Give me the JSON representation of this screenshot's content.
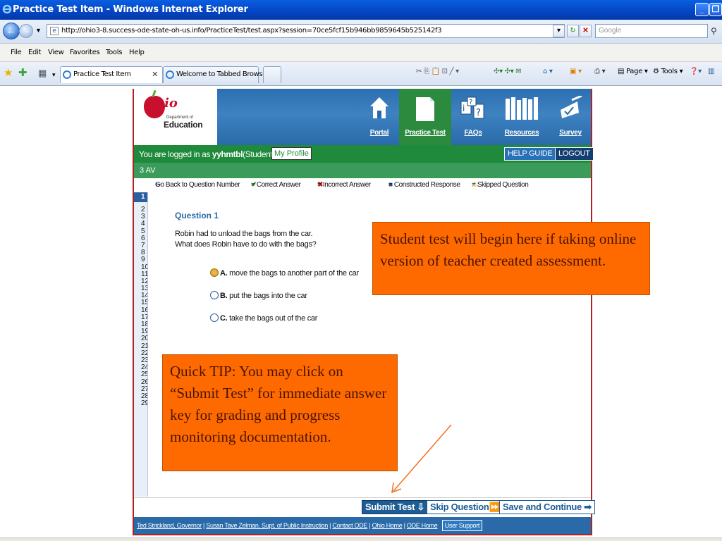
{
  "window": {
    "title": "Practice Test Item - Windows Internet Explorer",
    "url": "http://ohio3-8.success-ode-state-oh-us.info/PracticeTest/test.aspx?session=70ce5fcf15b946bb9859645b525142f3",
    "search_placeholder": "Google"
  },
  "menu": {
    "file": "File",
    "edit": "Edit",
    "view": "View",
    "favorites": "Favorites",
    "tools": "Tools",
    "help": "Help"
  },
  "tabs": [
    {
      "label": "Practice Test Item"
    },
    {
      "label": "Welcome to Tabbed Browsing"
    }
  ],
  "toolbar": {
    "page": "Page",
    "tools": "Tools"
  },
  "site": {
    "dept_line": "Department of",
    "edu_line": "Education",
    "nav": [
      {
        "label": "Portal"
      },
      {
        "label": "Practice Test"
      },
      {
        "label": "FAQs"
      },
      {
        "label": "Resources"
      },
      {
        "label": "Survey"
      }
    ]
  },
  "session": {
    "prefix": "You are logged in as ",
    "username": "yyhmtbl",
    "role": "(Student)",
    "profile": "My Profile",
    "help_guide": "HELP GUIDE",
    "logout": "LOGOUT"
  },
  "section": "3 AV",
  "legend": {
    "back": "Go Back to Question Number",
    "correct": "= Correct Answer",
    "incorrect": "= Incorrect Answer",
    "constructed": "= Constructed Response",
    "skipped": "= Skipped Question"
  },
  "question_numbers": [
    "1",
    "2",
    "3",
    "4",
    "5",
    "6",
    "7",
    "8",
    "9",
    "10",
    "11",
    "12",
    "13",
    "14",
    "15",
    "16",
    "17",
    "18",
    "19",
    "20",
    "21",
    "22",
    "23",
    "24",
    "25",
    "26",
    "27",
    "28",
    "29"
  ],
  "question": {
    "title": "Question 1",
    "line1": "Robin had to unload the bags from the car.",
    "line2": "What does Robin have to do with the bags?",
    "answers": [
      {
        "letter": "A.",
        "text": "move the bags to another part of the car",
        "selected": true
      },
      {
        "letter": "B.",
        "text": "put the bags into the car",
        "selected": false
      },
      {
        "letter": "C.",
        "text": "take the bags out of the car",
        "selected": false
      }
    ]
  },
  "actions": {
    "submit": "Submit Test",
    "skip": "Skip Question",
    "save": "Save and Continue"
  },
  "footer": {
    "links": [
      "Ted Strickland, Governor",
      "Susan Tave Zelman, Supt. of Public Instruction",
      "Contact ODE",
      "Ohio Home",
      "ODE Home"
    ],
    "support": "User Support"
  },
  "callouts": {
    "one": "Student test will begin here if taking online version of teacher created assessment.",
    "two": "Quick TIP:  You may click on “Submit Test” for immediate answer key for grading and progress monitoring documentation."
  },
  "colors": {
    "accent_blue": "#2a6aa8",
    "green": "#1f8a3b",
    "callout_orange": "#ff6a00",
    "frame_red": "#b22222"
  }
}
